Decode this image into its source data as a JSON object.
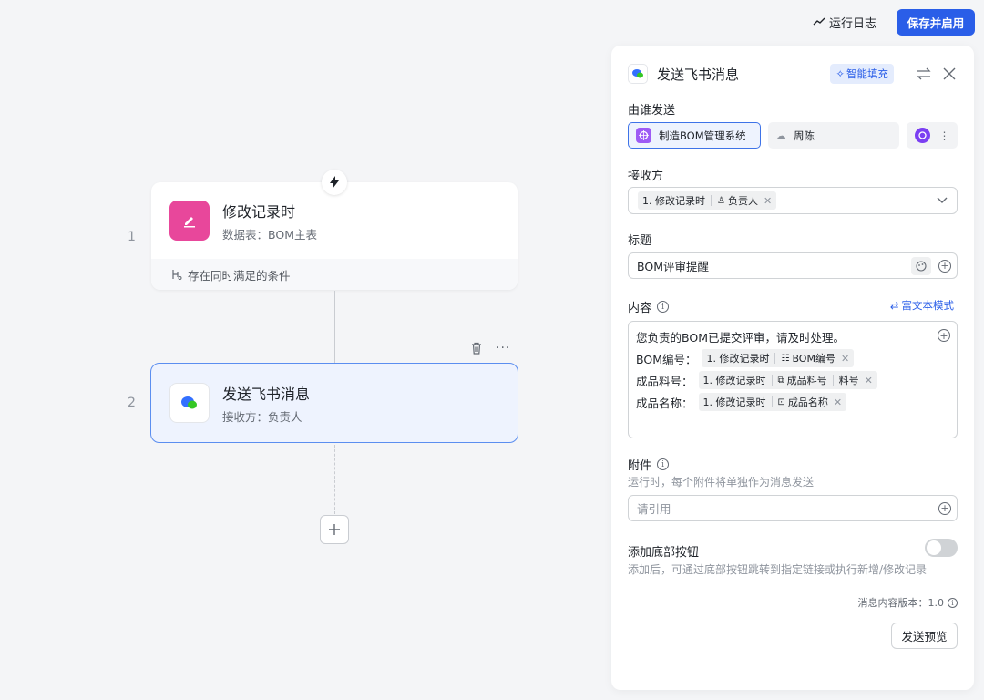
{
  "toolbar": {
    "run_log_label": "运行日志",
    "save_enable_label": "保存并启用"
  },
  "canvas": {
    "node1": {
      "step": "1",
      "title": "修改记录时",
      "subtitle": "数据表：BOM主表",
      "condition": "存在同时满足的条件",
      "icon": "edit-icon"
    },
    "node2": {
      "step": "2",
      "title": "发送飞书消息",
      "subtitle": "接收方：负责人",
      "icon": "feishu-message-icon"
    }
  },
  "panel": {
    "title": "发送飞书消息",
    "smart_fill_label": "智能填充",
    "sender_section": {
      "label": "由谁发送",
      "options": [
        {
          "label": "制造BOM管理系统",
          "selected": true
        },
        {
          "label": "周陈",
          "selected": false
        }
      ]
    },
    "receiver_section": {
      "label": "接收方",
      "tag_source": "1. 修改记录时",
      "tag_field": "负责人"
    },
    "title_section": {
      "label": "标题",
      "value": "BOM评审提醒"
    },
    "content_section": {
      "label": "内容",
      "rich_text_mode_label": "富文本模式",
      "first_line": "您负责的BOM已提交评审，请及时处理。",
      "lines": [
        {
          "prefix": "BOM编号：",
          "source": "1. 修改记录时",
          "field": "BOM编号",
          "extra": ""
        },
        {
          "prefix": "成品料号：",
          "source": "1. 修改记录时",
          "field": "成品料号",
          "extra": "料号"
        },
        {
          "prefix": "成品名称：",
          "source": "1. 修改记录时",
          "field": "成品名称",
          "extra": ""
        }
      ]
    },
    "attachment_section": {
      "label": "附件",
      "hint": "运行时，每个附件将单独作为消息发送",
      "placeholder": "请引用"
    },
    "bottom_button_section": {
      "label": "添加底部按钮",
      "hint": "添加后，可通过底部按钮跳转到指定链接或执行新增/修改记录",
      "enabled": false
    },
    "version_label": "消息内容版本：1.0",
    "preview_label": "发送预览"
  },
  "colors": {
    "accent": "#2a5ee8",
    "node1_icon_bg": "#e8479b",
    "app_icon_bg": "#9e5bf5",
    "selected_node_border": "#5b8ef0"
  }
}
